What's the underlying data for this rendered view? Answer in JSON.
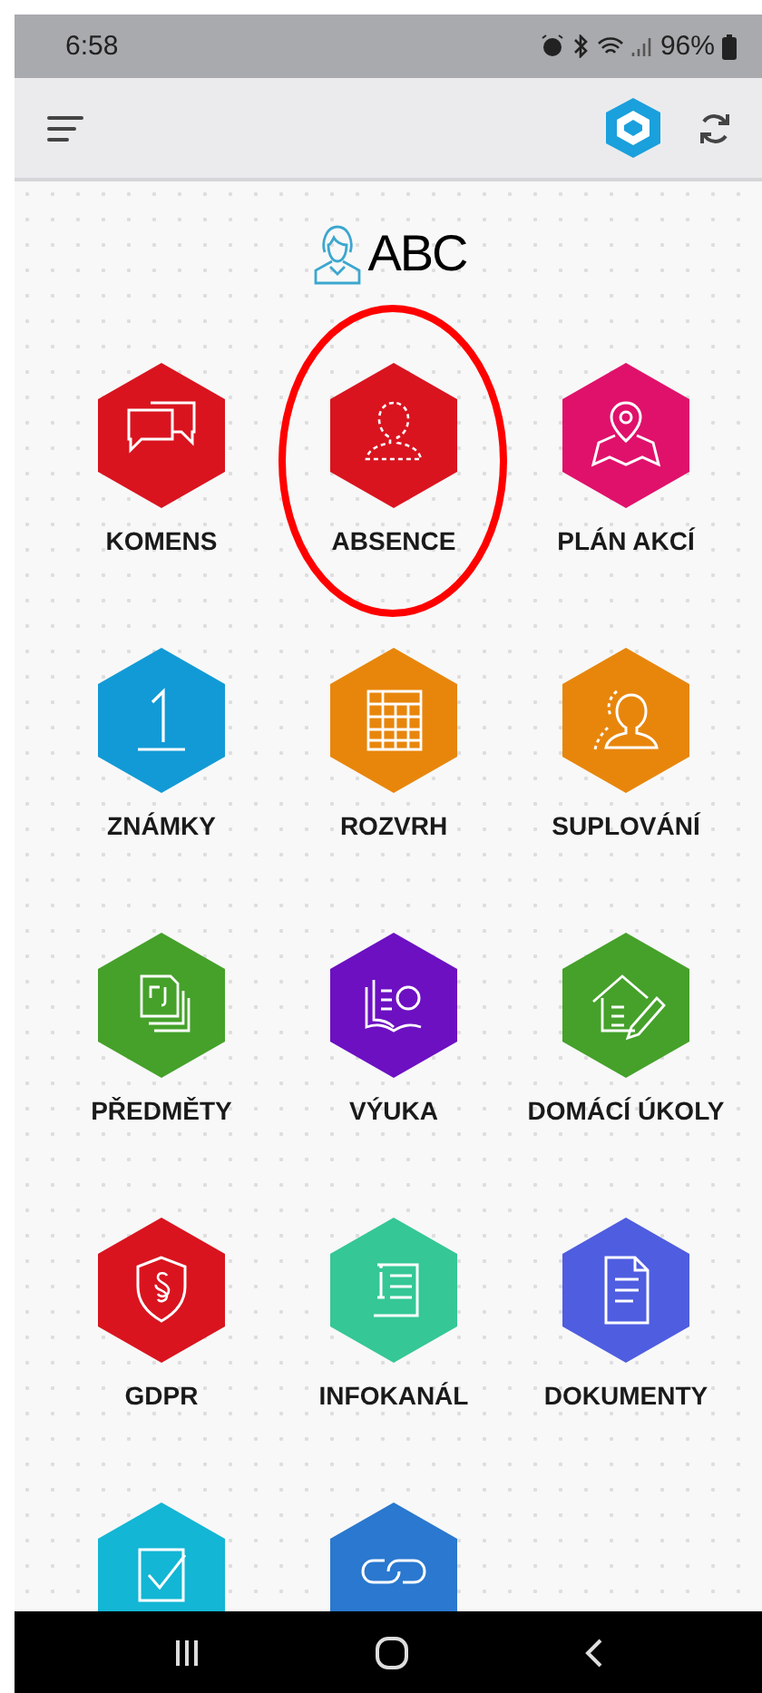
{
  "status_bar": {
    "time": "6:58",
    "battery": "96%"
  },
  "header": {
    "user_name": "ABC"
  },
  "tiles": [
    {
      "label": "KOMENS",
      "kind": "chat",
      "color": "#d9141f",
      "circled": false
    },
    {
      "label": "ABSENCE",
      "kind": "absence",
      "color": "#d9141f",
      "circled": true
    },
    {
      "label": "PLÁN AKCÍ",
      "kind": "map",
      "color": "#e0116b",
      "circled": false
    },
    {
      "label": "ZNÁMKY",
      "kind": "grade",
      "color": "#129ad6",
      "circled": false
    },
    {
      "label": "ROZVRH",
      "kind": "table",
      "color": "#e8860c",
      "circled": false
    },
    {
      "label": "SUPLOVÁNÍ",
      "kind": "substitute",
      "color": "#e8860c",
      "circled": false
    },
    {
      "label": "PŘEDMĚTY",
      "kind": "subjects",
      "color": "#45a12a",
      "circled": false
    },
    {
      "label": "VÝUKA",
      "kind": "book",
      "color": "#6c10c2",
      "circled": false
    },
    {
      "label": "DOMÁCÍ ÚKOLY",
      "kind": "homework",
      "color": "#45a12a",
      "circled": false
    },
    {
      "label": "GDPR",
      "kind": "shield",
      "color": "#d9141f",
      "circled": false
    },
    {
      "label": "INFOKANÁL",
      "kind": "info",
      "color": "#35c796",
      "circled": false
    },
    {
      "label": "DOKUMENTY",
      "kind": "document",
      "color": "#4f5de0",
      "circled": false
    },
    {
      "kind": "check",
      "color": "#13b6d4",
      "circled": false
    },
    {
      "kind": "link",
      "color": "#2a78cf",
      "circled": false
    }
  ]
}
